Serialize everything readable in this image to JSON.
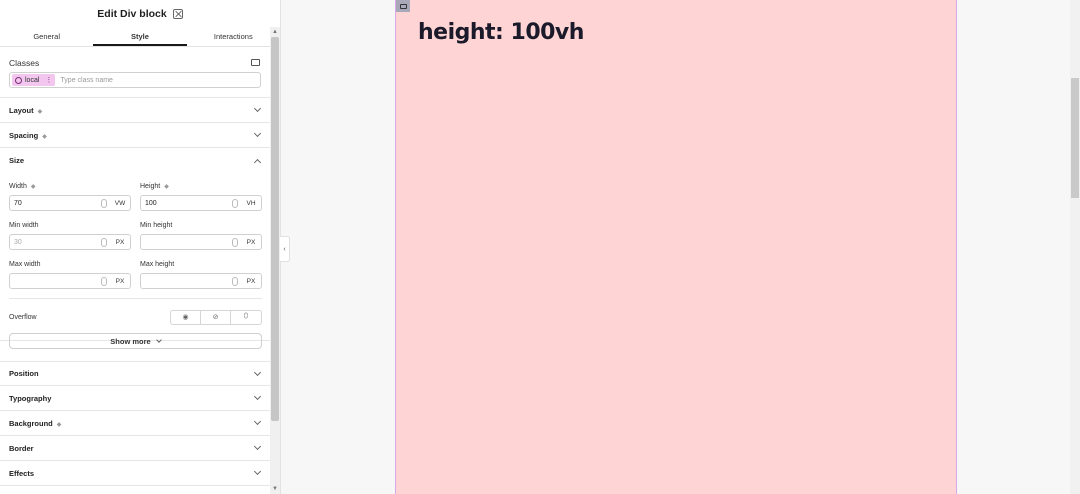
{
  "panel": {
    "title": "Edit Div block",
    "tabs": [
      {
        "label": "General"
      },
      {
        "label": "Style"
      },
      {
        "label": "Interactions"
      }
    ],
    "classes": {
      "label": "Classes",
      "chip": "local",
      "placeholder": "Type class name"
    },
    "sections": {
      "layout": "Layout",
      "spacing": "Spacing",
      "size": "Size",
      "position": "Position",
      "typography": "Typography",
      "background": "Background",
      "border": "Border",
      "effects": "Effects"
    },
    "size": {
      "width": {
        "label": "Width",
        "value": "70",
        "unit": "VW"
      },
      "height": {
        "label": "Height",
        "value": "100",
        "unit": "VH"
      },
      "min_width": {
        "label": "Min width",
        "placeholder": "30",
        "unit": "PX"
      },
      "min_height": {
        "label": "Min height",
        "value": "",
        "unit": "PX"
      },
      "max_width": {
        "label": "Max width",
        "value": "",
        "unit": "PX"
      },
      "max_height": {
        "label": "Max height",
        "value": "",
        "unit": "PX"
      },
      "overflow_label": "Overflow",
      "show_more": "Show more"
    }
  },
  "canvas": {
    "heading": "height: 100vh",
    "box_color": "#ffd4d4"
  }
}
